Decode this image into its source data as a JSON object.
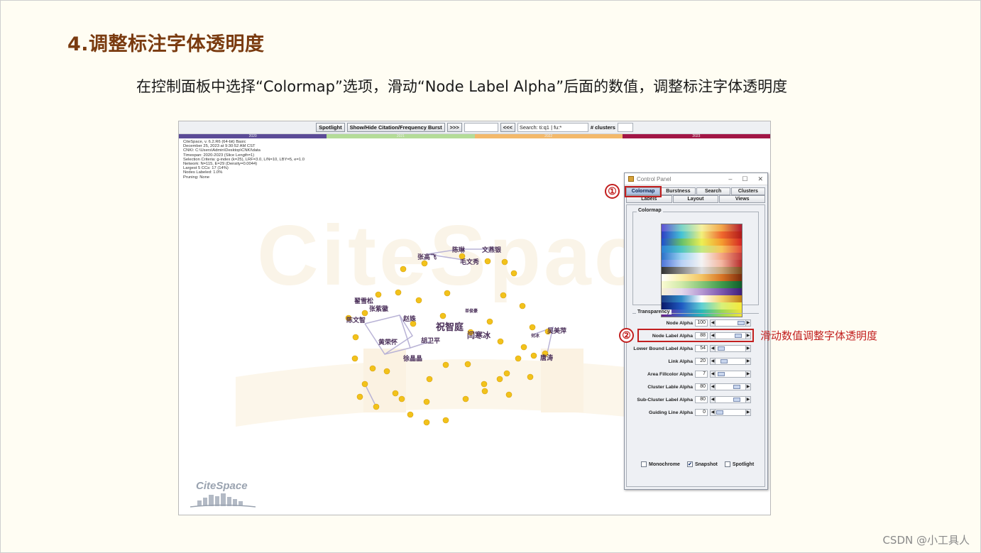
{
  "slide": {
    "title": "4.调整标注字体透明度",
    "subtitle": "在控制面板中选择“Colormap”选项，滑动“Node Label Alpha”后面的数值，调整标注字体透明度",
    "footer": "CSDN @小工具人"
  },
  "toolbar": {
    "spotlight": "Spotlight",
    "burst": "Show/Hide Citation/Frequency Burst",
    "next": ">>>",
    "prev": "<<<",
    "search_value": "Search: ti:q1 | fu:*",
    "clusters_label": "# clusters"
  },
  "timeline": {
    "labels": [
      "2020",
      "2021",
      "2022",
      "2023"
    ],
    "colors": [
      "#5b4b97",
      "#b4dc98",
      "#f3b96b",
      "#a21646"
    ]
  },
  "info_lines": [
    "CiteSpace, v. 6.2.R6 (64-bit) Basic",
    "December 25, 2023 at 9:30:52 AM CST",
    "CNKI: C:\\Users\\Admin\\Desktop\\CNKI\\data",
    "Timespan: 2020-2023 (Slice Length=1)",
    "Selection Criteria: g-index (k=25), LRF=3.0, L/N=10, LBY=5, e=1.0",
    "Network: N=115, E=29 (Density=0.0044)",
    "Largest 5 CCs: 17 (14%)",
    "Nodes Labeled: 1.0%",
    "Pruning: None"
  ],
  "background_watermark": "CiteSpace",
  "logo_text": "CiteSpace",
  "network": {
    "labels": [
      {
        "text": "张高飞",
        "size": 9
      },
      {
        "text": "陈琳",
        "size": 9
      },
      {
        "text": "文燕银",
        "size": 9
      },
      {
        "text": "毛文秀",
        "size": 9
      },
      {
        "text": "翟雪松",
        "size": 9
      },
      {
        "text": "张紫徽",
        "size": 9
      },
      {
        "text": "陈文智",
        "size": 9
      },
      {
        "text": "赵姝",
        "size": 9
      },
      {
        "text": "单俊豪",
        "size": 6
      },
      {
        "text": "祝智庭",
        "size": 13
      },
      {
        "text": "闫寒冰",
        "size": 11
      },
      {
        "text": "黄荣怀",
        "size": 9
      },
      {
        "text": "胡卫平",
        "size": 9
      },
      {
        "text": "徐晶晶",
        "size": 9
      },
      {
        "text": "何冰",
        "size": 6
      },
      {
        "text": "吴美萍",
        "size": 9
      },
      {
        "text": "唐涛",
        "size": 9
      }
    ]
  },
  "control_panel": {
    "title": "Control Panel",
    "tabs_row1": [
      "Colormap",
      "Burstness",
      "Search",
      "Clusters"
    ],
    "tabs_row2": [
      "Labels",
      "Layout",
      "Views"
    ],
    "active_tab": "Colormap",
    "colormap_title": "Colormap",
    "transparency_title": "Transparency",
    "sliders": [
      {
        "label": "Node Alpha",
        "value": "100",
        "fraction": 1.0
      },
      {
        "label": "Node Label Alpha",
        "value": "88",
        "fraction": 0.88
      },
      {
        "label": "Lower Bound Label Alpha",
        "value": "54",
        "fraction": 0.05
      },
      {
        "label": "Link Alpha",
        "value": "20",
        "fraction": 0.2
      },
      {
        "label": "Area Fillcolor Alpha",
        "value": "7",
        "fraction": 0.07
      },
      {
        "label": "Cluster Lable Alpha",
        "value": "80",
        "fraction": 0.8
      },
      {
        "label": "Sub-Cluster Label Alpha",
        "value": "80",
        "fraction": 0.8
      },
      {
        "label": "Guiding Line Alpha",
        "value": "0",
        "fraction": 0.0
      }
    ],
    "checkboxes": [
      {
        "label": "Monochrome",
        "checked": false
      },
      {
        "label": "Snapshot",
        "checked": true
      },
      {
        "label": "Spotlight",
        "checked": false
      }
    ]
  },
  "annotations": {
    "marker1": "①",
    "marker2": "②",
    "note": "滑动数值调整字体透明度"
  }
}
